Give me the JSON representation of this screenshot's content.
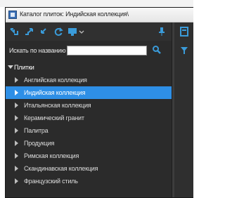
{
  "window": {
    "title": "Каталог плиток: Индийская коллекция\\",
    "icon": "catalog-app-icon"
  },
  "toolbar": {
    "buttons": [
      {
        "icon": "expand-all-icon"
      },
      {
        "icon": "collapse-all-icon"
      },
      {
        "icon": "collapse-branch-icon"
      },
      {
        "icon": "refresh-icon"
      },
      {
        "icon": "view-options-icon"
      },
      {
        "icon": "chevron-down-icon"
      },
      {
        "icon": "pin-icon"
      }
    ],
    "right_icons": [
      "panel-icon",
      "filter-icon"
    ]
  },
  "search": {
    "label": "Искать по названию",
    "value": "",
    "icon": "search-icon"
  },
  "tree": {
    "root": {
      "label": "Плитки",
      "expanded": true
    },
    "items": [
      {
        "label": "Английская коллекция",
        "selected": false
      },
      {
        "label": "Индийская коллекция",
        "selected": true
      },
      {
        "label": "Итальянская коллекция",
        "selected": false
      },
      {
        "label": "Керамический гранит",
        "selected": false
      },
      {
        "label": "Палитра",
        "selected": false
      },
      {
        "label": "Продукция",
        "selected": false
      },
      {
        "label": "Римская коллекция",
        "selected": false
      },
      {
        "label": "Скандинавская коллекция",
        "selected": false
      },
      {
        "label": "Французский стиль",
        "selected": false
      }
    ]
  },
  "colors": {
    "panel_bg": "#2b2b2b",
    "selection": "#2e8fe6",
    "toolbar_accent": "#3a9bd9"
  }
}
